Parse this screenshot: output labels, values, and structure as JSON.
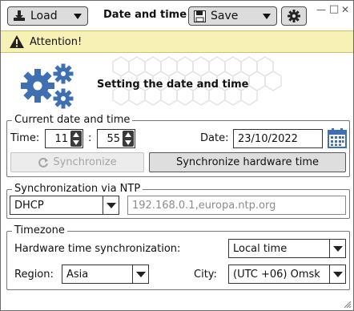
{
  "toolbar": {
    "load_label": "Load",
    "save_label": "Save",
    "title": "Date and time"
  },
  "window_controls": {
    "minimize": "—",
    "maximize": "□",
    "close": "✕"
  },
  "attention": {
    "text": "Attention!",
    "color": "#f7f1b5"
  },
  "header": {
    "title": "Setting the date and time"
  },
  "current": {
    "legend": "Current date and time",
    "time_label": "Time:",
    "hours": "11",
    "separator": ":",
    "minutes": "55",
    "date_label": "Date:",
    "date": "23/10/2022",
    "sync_label": "Synchronize",
    "sync_hw_label": "Synchronize hardware time"
  },
  "ntp": {
    "legend": "Synchronization via NTP",
    "mode": "DHCP",
    "servers_placeholder": "192.168.0.1,europa.ntp.org"
  },
  "timezone": {
    "legend": "Timezone",
    "hw_sync_label": "Hardware time synchronization:",
    "hw_sync_value": "Local time",
    "region_label": "Region:",
    "region_value": "Asia",
    "city_label": "City:",
    "city_value": "(UTC +06) Omsk"
  },
  "icons": {
    "load": "download-icon",
    "save": "floppy-disk-icon",
    "settings": "gear-icon",
    "attention": "warning-icon",
    "header": "gears-icon",
    "calendar": "calendar-icon",
    "sync": "refresh-icon"
  },
  "colors": {
    "accent_blue": "#3f6fb0",
    "disabled_text": "#a5a5a5"
  }
}
